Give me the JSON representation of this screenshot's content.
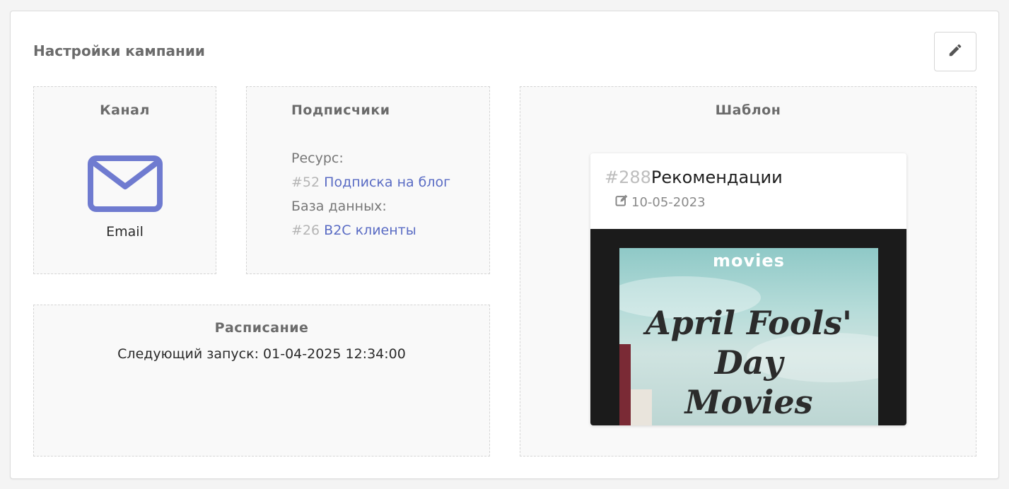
{
  "card": {
    "title": "Настройки кампании",
    "edit_icon": "pencil-icon"
  },
  "channel": {
    "title": "Канал",
    "icon": "envelope-icon",
    "label": "Email",
    "icon_color": "#6f7bd0"
  },
  "subscribers": {
    "title": "Подписчики",
    "resource_label": "Ресурс:",
    "resource_id": "#52",
    "resource_name": "Подписка на блог",
    "database_label": "База данных:",
    "database_id": "#26",
    "database_name": "B2C клиенты",
    "link_color": "#5a6cc4"
  },
  "schedule": {
    "title": "Расписание",
    "next_run": "Следующий запуск: 01-04-2025 12:34:00"
  },
  "template": {
    "title": "Шаблон",
    "id": "#288",
    "name": "Рекомендации",
    "date_icon": "edit-square-icon",
    "date": "10-05-2023",
    "preview": {
      "brand": "movies",
      "headline_1": "April Fools'",
      "headline_2": "Day",
      "headline_3": "Movies"
    }
  }
}
